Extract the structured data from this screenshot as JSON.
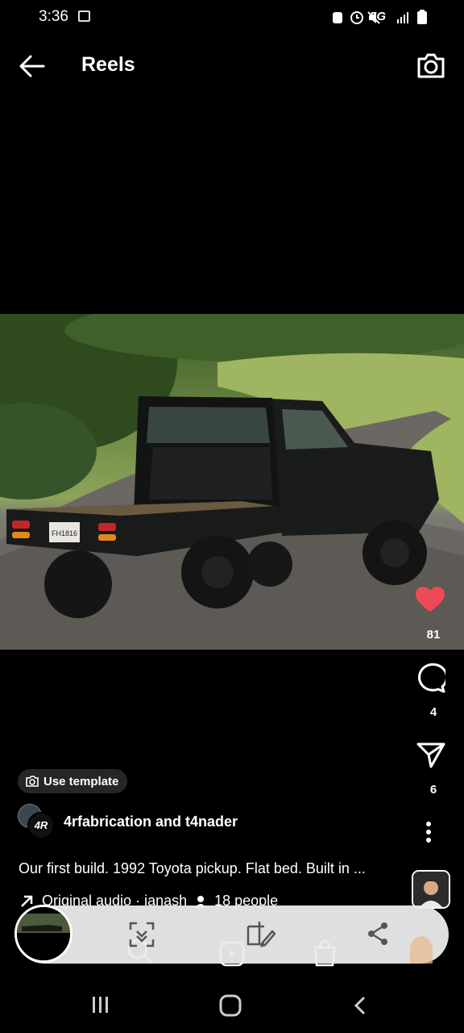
{
  "status": {
    "time": "3:36",
    "network": "5G"
  },
  "header": {
    "title": "Reels"
  },
  "post": {
    "likes": "81",
    "comments": "4",
    "shares": "6",
    "use_template_label": "Use template",
    "author": "4rfabrication and t4nader",
    "caption": "Our first build. 1992 Toyota pickup. Flat bed. Built in ...",
    "audio": "Original audio · ianash",
    "people": "18 people",
    "plate": "FH1816"
  },
  "colors": {
    "like": "#ed4956",
    "overlay": "#e6e6e6"
  },
  "icons": [
    "arrow-left-icon",
    "camera-icon",
    "heart-icon",
    "comment-icon",
    "send-icon",
    "more-icon",
    "scan-icon",
    "edit-icon",
    "share-icon",
    "search-icon",
    "reels-icon",
    "shop-icon"
  ]
}
